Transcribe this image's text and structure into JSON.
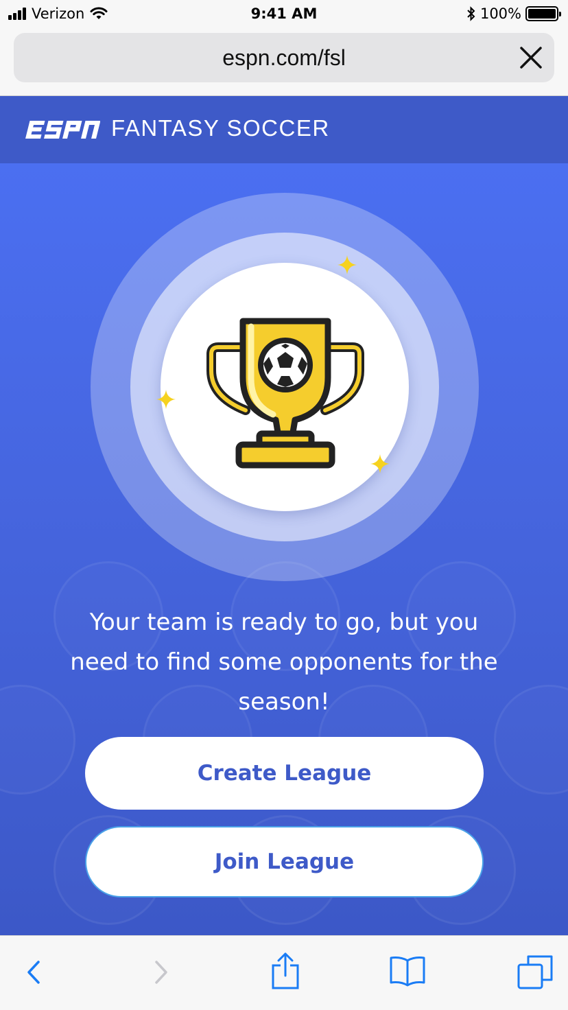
{
  "status_bar": {
    "carrier": "Verizon",
    "time": "9:41 AM",
    "battery": "100%"
  },
  "browser": {
    "url": "espn.com/fsl"
  },
  "header": {
    "brand_title": "FANTASY SOCCER"
  },
  "main": {
    "message": "Your team is ready to go, but you need to find some opponents for the season!",
    "create_button": "Create League",
    "join_button": "Join League"
  },
  "icons": {
    "signal": "signal-icon",
    "wifi": "wifi-icon",
    "bluetooth": "bluetooth-icon",
    "battery": "battery-icon",
    "close": "close-icon",
    "trophy": "trophy-icon",
    "back": "back-icon",
    "forward": "forward-icon",
    "share": "share-icon",
    "bookmarks": "bookmarks-icon",
    "tabs": "tabs-icon"
  },
  "colors": {
    "header": "#3e5ac8",
    "accent": "#4b6ff1",
    "trophy_gold": "#f5cd2d",
    "ios_blue": "#1a7cf5"
  }
}
